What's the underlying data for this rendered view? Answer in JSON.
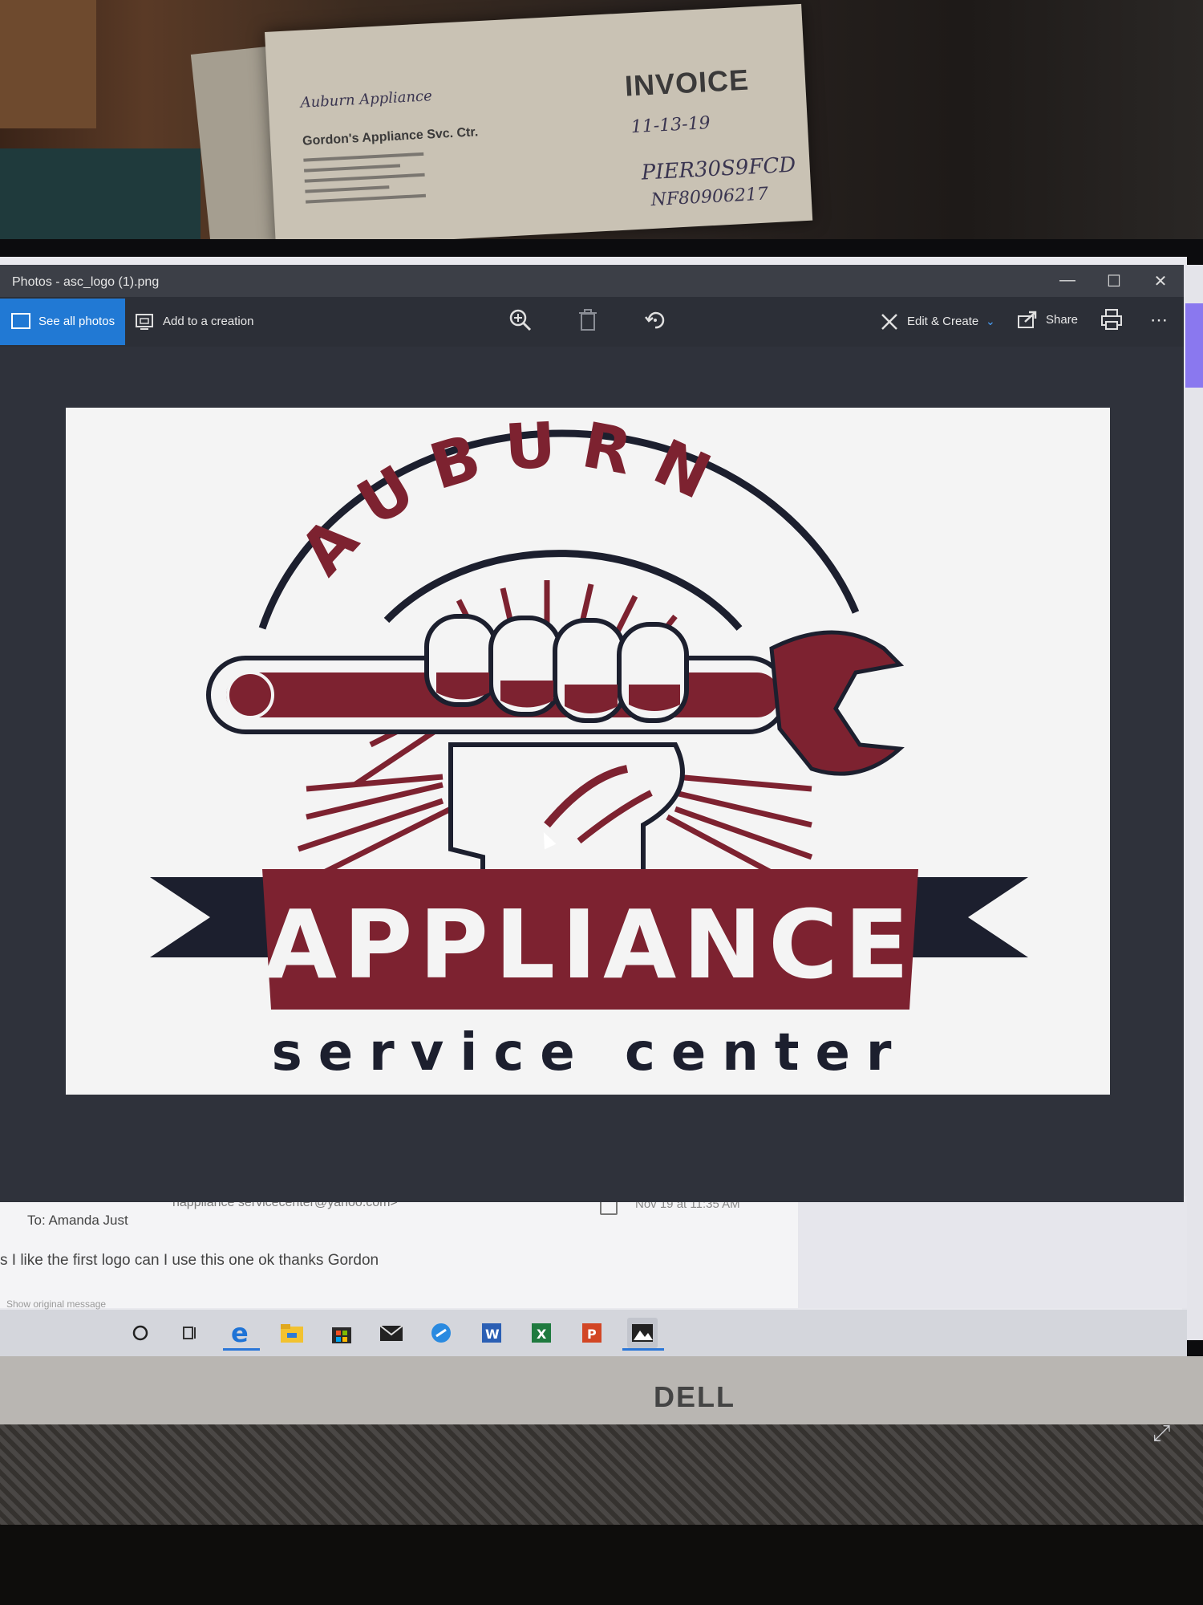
{
  "window": {
    "title": "Photos - asc_logo (1).png",
    "minimize": "—",
    "maximize": "☐",
    "close": "✕"
  },
  "toolbar": {
    "see_all_photos": "See all photos",
    "add_to_creation": "Add to a creation",
    "edit_create": "Edit & Create",
    "share": "Share",
    "more": "⋯",
    "icons": [
      "zoom-icon",
      "delete-icon",
      "rotate-icon",
      "edit-icon",
      "share-icon",
      "print-icon"
    ]
  },
  "logo": {
    "top_word": "AUBURN",
    "middle_word": "APPLIANCE",
    "bottom_words": "service center",
    "colors": {
      "maroon": "#7d2230",
      "navy": "#1c1f2e",
      "background": "#f4f4f4"
    }
  },
  "mail": {
    "from": "nappliance servicecenter@yahoo.com>",
    "to": "To: Amanda Just",
    "date": "Nov 19 at 11:35 AM",
    "body": "s I like the first logo can I use this one ok thanks Gordon",
    "show_original": "Show original message"
  },
  "taskbar": {
    "items": [
      "cortana-icon",
      "task-view-icon",
      "edge-icon",
      "file-explorer-icon",
      "store-icon",
      "mail-icon",
      "other-app-icon",
      "word-icon",
      "excel-icon",
      "powerpoint-icon",
      "photos-icon"
    ]
  },
  "background": {
    "invoice_label": "INVOICE",
    "handwritten_1": "Auburn Appliance",
    "printed_company": "Gordon's Appliance Svc. Ctr.",
    "handwritten_date": "11-13-19",
    "handwritten_code1": "PIER30S9FCD",
    "handwritten_code2": "NF80906217",
    "monitor_brand": "DELL"
  }
}
